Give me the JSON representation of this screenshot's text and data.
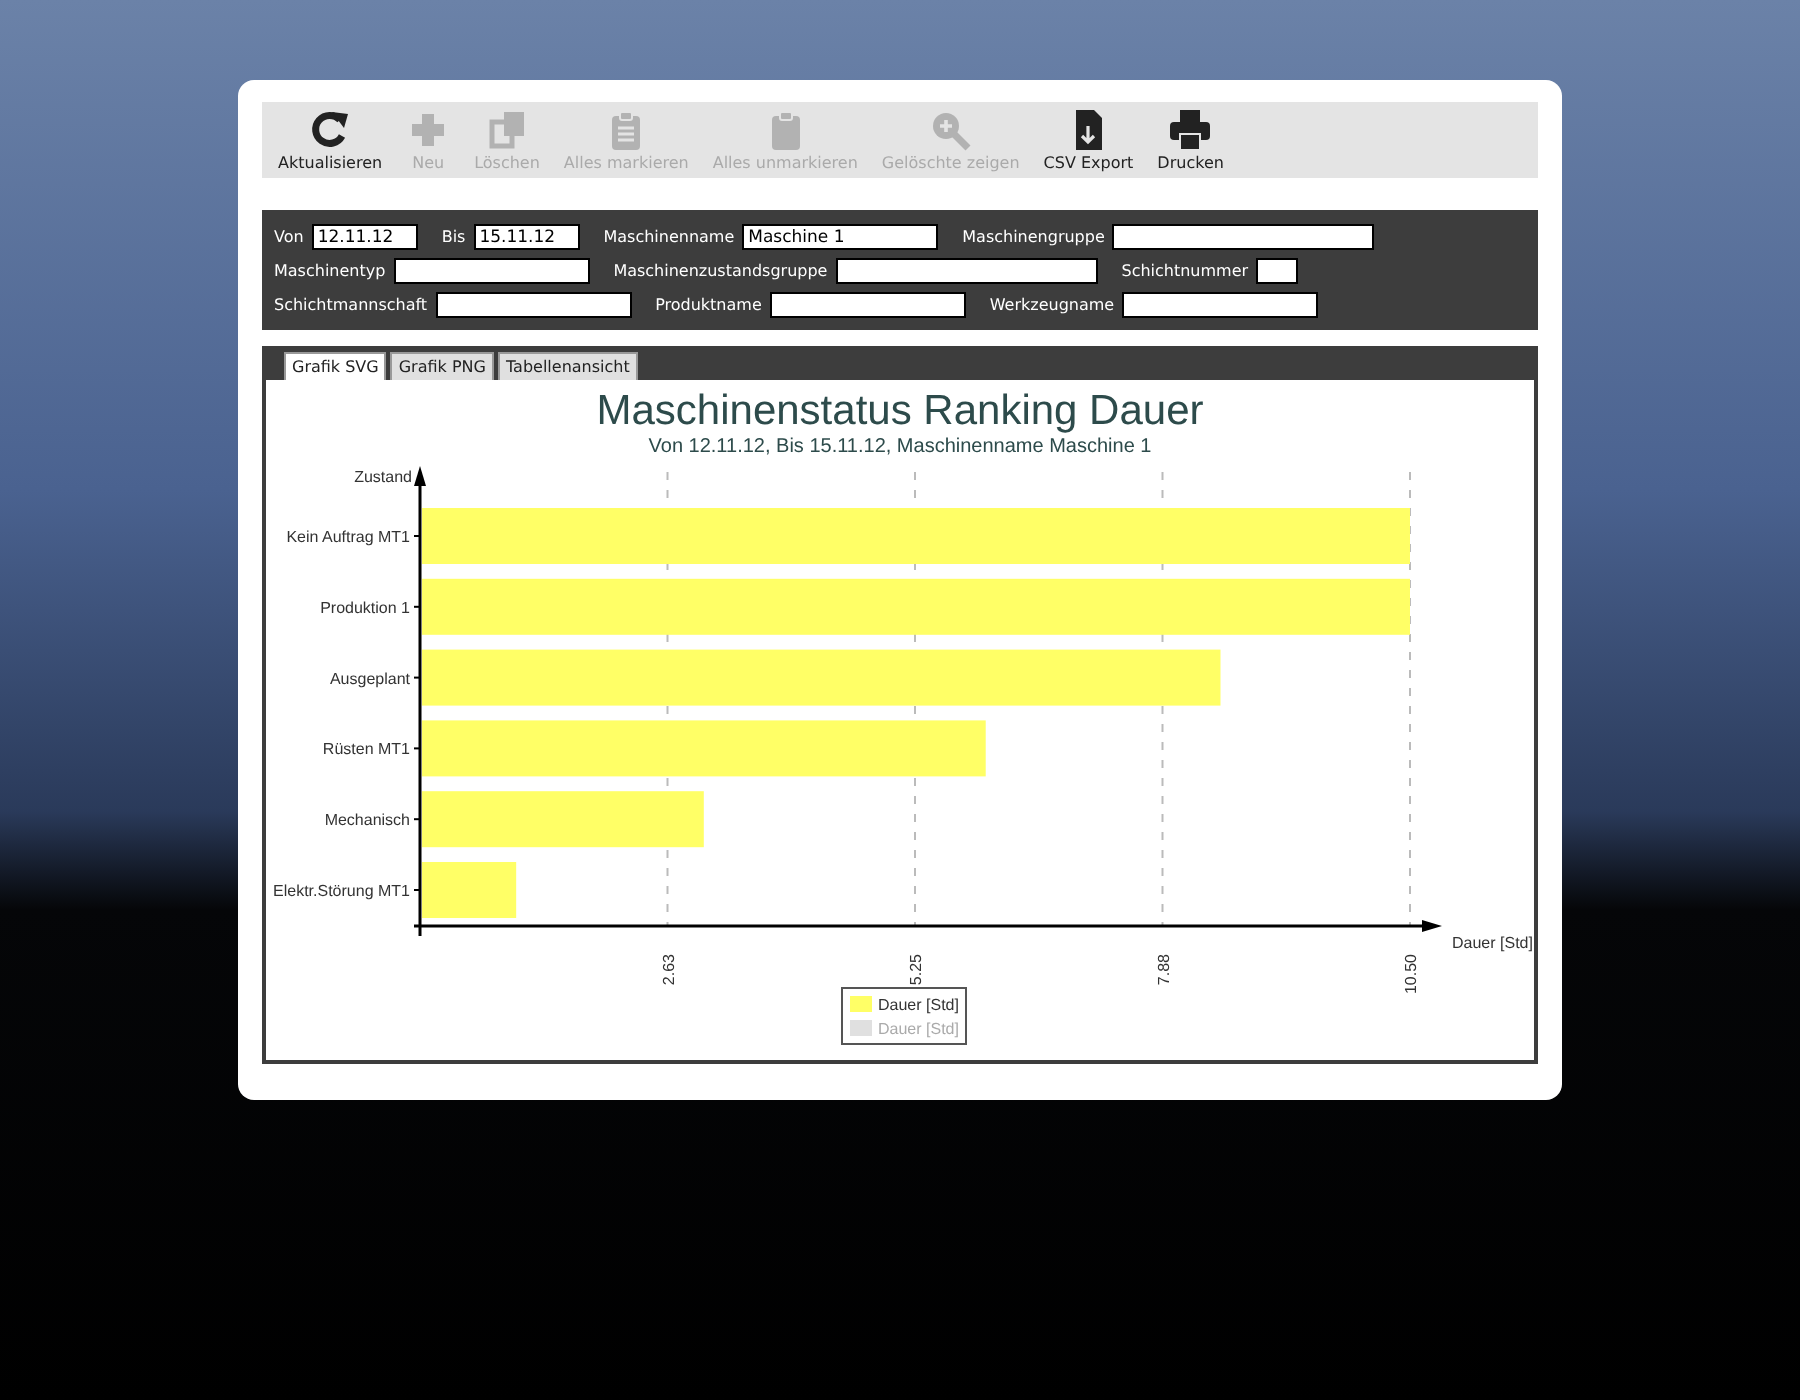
{
  "toolbar": [
    {
      "label": "Aktualisieren",
      "kind": "refresh",
      "disabled": false
    },
    {
      "label": "Neu",
      "kind": "plus",
      "disabled": true
    },
    {
      "label": "Löschen",
      "kind": "copy",
      "disabled": true
    },
    {
      "label": "Alles markieren",
      "kind": "clipboard-list",
      "disabled": true
    },
    {
      "label": "Alles unmarkieren",
      "kind": "clipboard",
      "disabled": true
    },
    {
      "label": "Gelöschte zeigen",
      "kind": "zoom",
      "disabled": true
    },
    {
      "label": "CSV Export",
      "kind": "file",
      "disabled": false
    },
    {
      "label": "Drucken",
      "kind": "printer",
      "disabled": false
    }
  ],
  "filters": [
    [
      {
        "label": "Von",
        "value": "12.11.12"
      },
      {
        "label": "Bis",
        "value": "15.11.12"
      },
      {
        "label": "Maschinenname",
        "value": "Maschine 1"
      },
      {
        "label": "Maschinengruppe"
      }
    ],
    [
      {
        "label": "Maschinentyp"
      },
      {
        "label": "Maschinenzustandsgruppe"
      },
      {
        "label": "Schichtnummer"
      }
    ],
    [
      {
        "label": "Schichtmannschaft"
      },
      {
        "label": "Produktname"
      },
      {
        "label": "Werkzeugname"
      }
    ]
  ],
  "tabs": [
    {
      "label": "Grafik SVG",
      "selected": true
    },
    {
      "label": "Grafik PNG",
      "selected": false
    },
    {
      "label": "Tabellenansicht",
      "selected": false
    }
  ],
  "chart": {
    "title": "Maschinenstatus Ranking Dauer",
    "subtitle": "Von 12.11.12, Bis 15.11.12, Maschinenname Maschine 1",
    "legend": [
      {
        "label": "Dauer [Std]",
        "color": "#e0e0e0",
        "disabled": true
      }
    ],
    "chart_data": {
      "type": "bar",
      "orientation": "horizontal",
      "xlabel": "Dauer [Std]",
      "ylabel": "Zustand",
      "categories": [
        "Kein Auftrag MT1",
        "Produktion 1",
        "Ausgeplant",
        "Rüsten MT1",
        "Mechanisch",
        "Elektr.Störung MT1"
      ],
      "series": [
        {
          "name": "Dauer [Std]",
          "color": "#ffff66",
          "values": [
            10.5,
            10.5,
            8.49,
            6.0,
            3.01,
            1.02
          ]
        }
      ],
      "grid": true,
      "xlim": [
        0,
        10.5
      ],
      "xticks": [
        {
          "value": 2.625,
          "label": "2.63"
        },
        {
          "value": 5.25,
          "label": "5.25"
        },
        {
          "value": 7.875,
          "label": "7.88"
        },
        {
          "value": 10.5,
          "label": "10.50"
        }
      ]
    }
  }
}
